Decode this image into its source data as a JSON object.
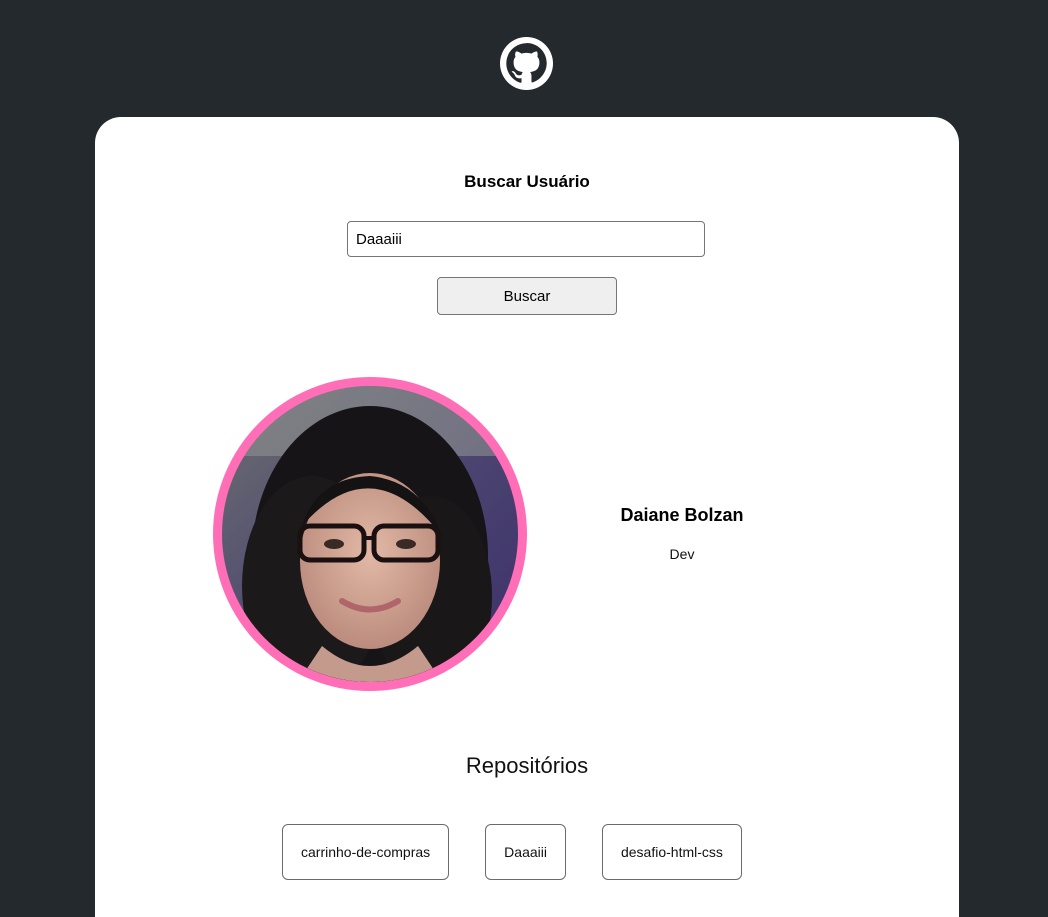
{
  "search": {
    "title": "Buscar Usuário",
    "input_value": "Daaaiii",
    "button_label": "Buscar"
  },
  "profile": {
    "name": "Daiane Bolzan",
    "bio": "Dev",
    "avatar_ring_color": "#ff6eb6"
  },
  "repositories": {
    "title": "Repositórios",
    "items": [
      {
        "name": "carrinho-de-compras"
      },
      {
        "name": "Daaaiii"
      },
      {
        "name": "desafio-html-css"
      }
    ]
  },
  "colors": {
    "page_background": "#24292e",
    "card_background": "#ffffff",
    "accent": "#ff6eb6"
  }
}
